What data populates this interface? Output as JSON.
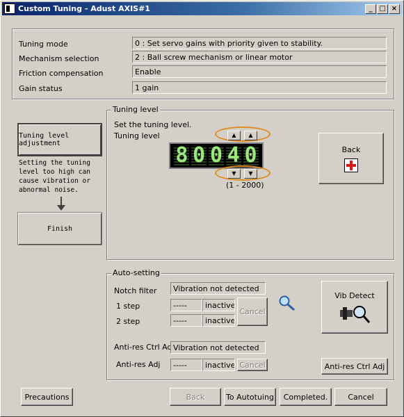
{
  "window": {
    "title": "Custom Tuning - Adust AXIS#1"
  },
  "titlebar_buttons": {
    "minimize": "_",
    "maximize": "□",
    "close": "×"
  },
  "info": {
    "tuning_mode_label": "Tuning mode",
    "tuning_mode_value": "0 : Set servo gains with priority given to stability.",
    "mechanism_label": "Mechanism selection",
    "mechanism_value": "2 : Ball screw mechanism or linear motor",
    "friction_label": "Friction compensation",
    "friction_value": "Enable",
    "gain_label": "Gain status",
    "gain_value": "1 gain"
  },
  "flow": {
    "step1": "Tuning level adjustment",
    "note": "Setting the tuning level too high can cause vibration or abnormal noise.",
    "step2": "Finish"
  },
  "tuning_level": {
    "group_title": "Tuning level",
    "instruction": "Set the tuning level.",
    "label": "Tuning level",
    "display_digits": [
      "8",
      "0",
      "0",
      "4",
      "0"
    ],
    "range": "(1 - 2000)",
    "back_label": "Back"
  },
  "auto_setting": {
    "group_title": "Auto-setting",
    "notch_label": "Notch filter",
    "notch_status": "Vibration not detected",
    "step1_label": "1 step",
    "step1_value": "-----",
    "step1_state": "inactive",
    "step2_label": "2 step",
    "step2_value": "-----",
    "step2_state": "inactive",
    "cancel_label": "Cancel",
    "vib_detect_label": "Vib Detect",
    "antires_ctrl_label": "Anti-res Ctrl Adj",
    "antires_ctrl_status": "Vibration not detected",
    "antires_adj_label": "Anti-res Adj",
    "antires_adj_value": "-----",
    "antires_adj_state": "inactive",
    "antires_cancel_label": "Cancel",
    "antires_ctrl_button": "Anti-res Ctrl Adj"
  },
  "footer": {
    "precautions": "Precautions",
    "back": "Back",
    "to_autotuing": "To Autotuing",
    "completed": "Completed.",
    "cancel": "Cancel"
  },
  "colors": {
    "highlight": "#e08a1e",
    "led": "#9be87d",
    "title_bar": "#0a246a"
  }
}
